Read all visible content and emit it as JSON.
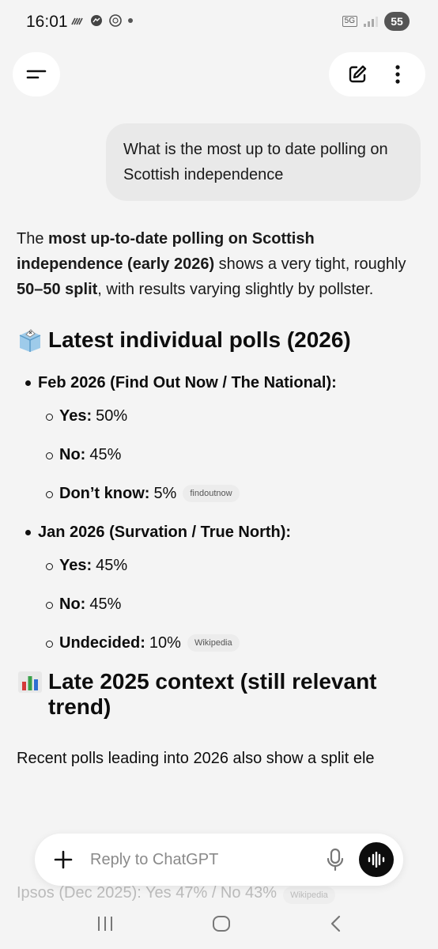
{
  "status": {
    "time": "16:01",
    "network": "5G",
    "battery": "55"
  },
  "user_message": "What is the most up to date polling on Scottish independence",
  "answer": {
    "intro_parts": [
      {
        "text": "The ",
        "bold": false
      },
      {
        "text": "most up-to-date polling on Scottish independence (early 2026)",
        "bold": true
      },
      {
        "text": " shows a very tight, roughly ",
        "bold": false
      },
      {
        "text": "50–50 split",
        "bold": true
      },
      {
        "text": ", with results varying slightly by pollster.",
        "bold": false
      }
    ],
    "section1_title": "Latest individual polls (2026)",
    "polls": [
      {
        "title": "Feb 2026 (Find Out Now / The National):",
        "items": [
          {
            "label": "Yes:",
            "value": "50%",
            "source": ""
          },
          {
            "label": "No:",
            "value": "45%",
            "source": ""
          },
          {
            "label": "Don’t know:",
            "value": "5%",
            "source": "findoutnow"
          }
        ]
      },
      {
        "title": "Jan 2026 (Survation / True North):",
        "items": [
          {
            "label": "Yes:",
            "value": "45%",
            "source": ""
          },
          {
            "label": "No:",
            "value": "45%",
            "source": ""
          },
          {
            "label": "Undecided:",
            "value": "10%",
            "source": "Wikipedia"
          }
        ]
      }
    ],
    "section2_title": "Late 2025 context (still relevant trend)",
    "section2_text": "Recent polls leading into 2026 also show a split ele",
    "faded_line": "Ipsos (Dec 2025): Yes 47% / No 43%",
    "faded_chip": "Wikipedia"
  },
  "composer": {
    "placeholder": "Reply to ChatGPT"
  },
  "colors": {
    "background": "#f4f4f4",
    "bubble": "#e9e9e9",
    "text": "#0d0d0d",
    "chip_bg": "#ececec"
  }
}
